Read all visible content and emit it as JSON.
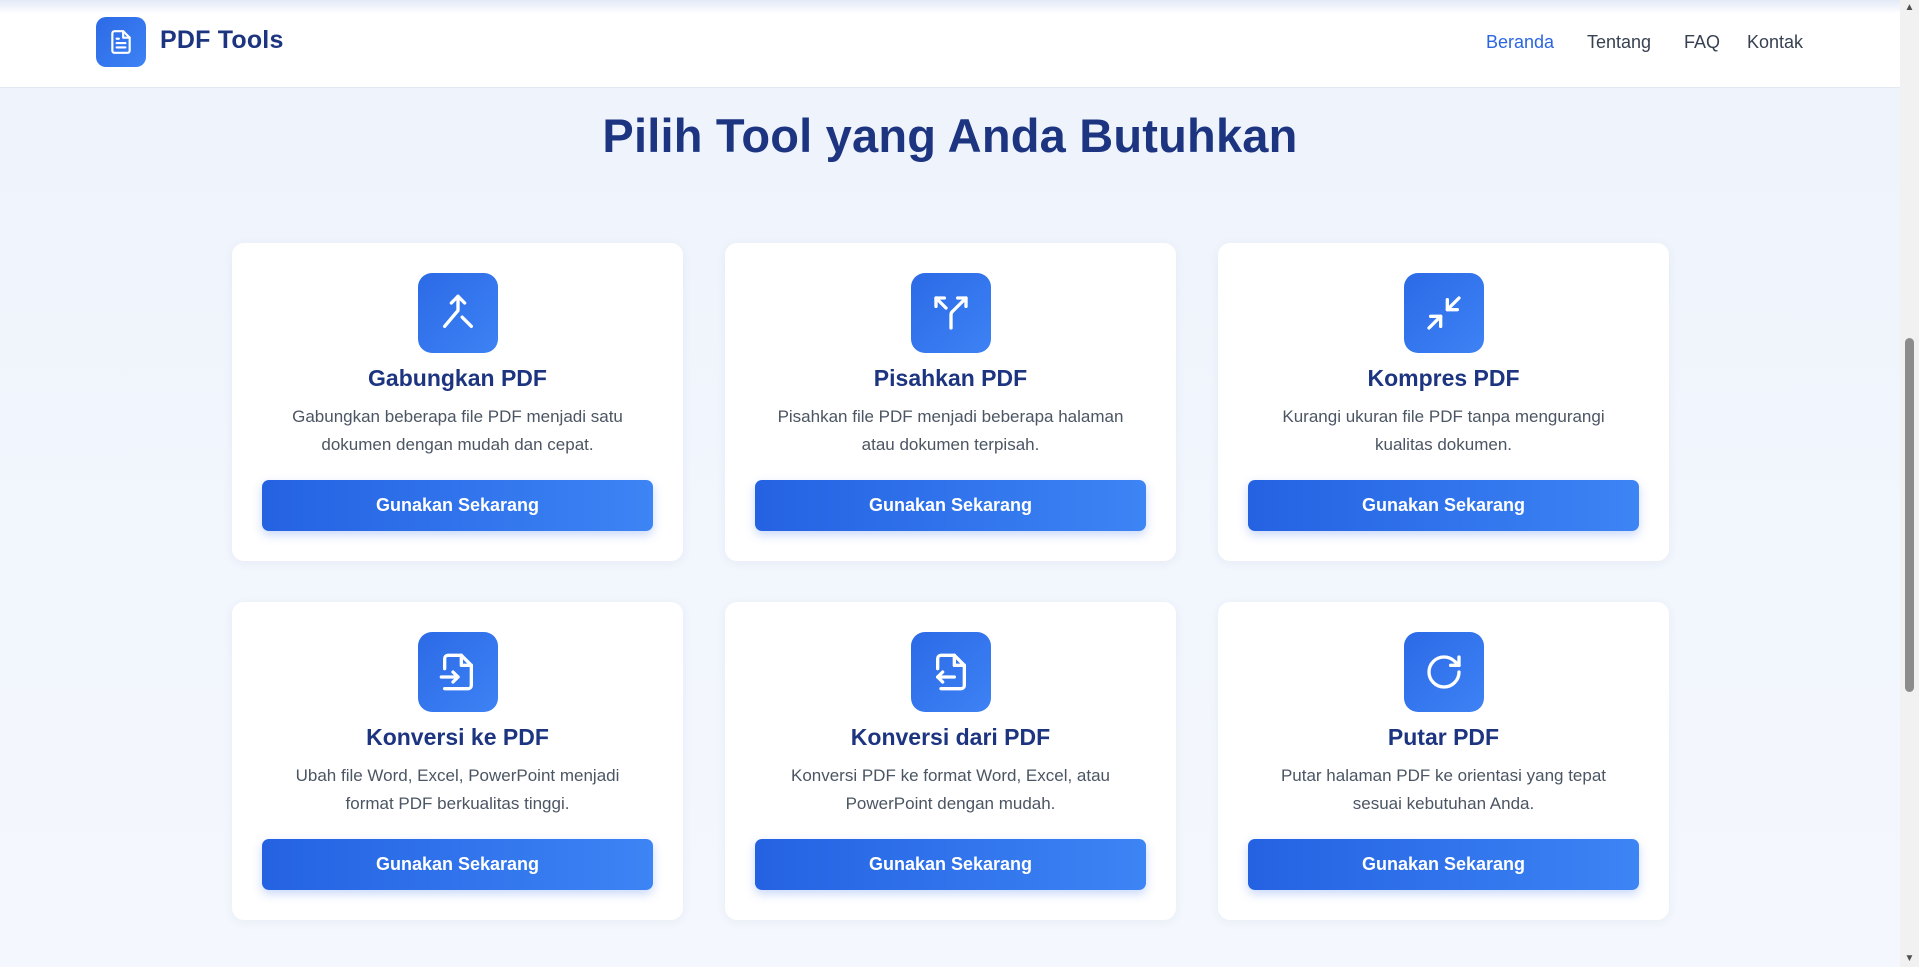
{
  "header": {
    "logo_icon": "document-icon",
    "logo_text": "PDF Tools",
    "nav": [
      {
        "label": "Beranda",
        "active": true
      },
      {
        "label": "Tentang",
        "active": false
      },
      {
        "label": "FAQ",
        "active": false
      },
      {
        "label": "Kontak",
        "active": false
      }
    ]
  },
  "main": {
    "title": "Pilih Tool yang Anda Butuhkan",
    "cards": [
      {
        "icon": "merge-icon",
        "title": "Gabungkan PDF",
        "desc_line1": "Gabungkan beberapa file PDF menjadi satu",
        "desc_line2": "dokumen dengan mudah dan cepat.",
        "button": "Gunakan Sekarang"
      },
      {
        "icon": "split-icon",
        "title": "Pisahkan PDF",
        "desc_line1": "Pisahkan file PDF menjadi beberapa halaman",
        "desc_line2": "atau dokumen terpisah.",
        "button": "Gunakan Sekarang"
      },
      {
        "icon": "compress-icon",
        "title": "Kompres PDF",
        "desc_line1": "Kurangi ukuran file PDF tanpa mengurangi",
        "desc_line2": "kualitas dokumen.",
        "button": "Gunakan Sekarang"
      },
      {
        "icon": "file-import-icon",
        "title": "Konversi ke PDF",
        "desc_line1": "Ubah file Word, Excel, PowerPoint menjadi",
        "desc_line2": "format PDF berkualitas tinggi.",
        "button": "Gunakan Sekarang"
      },
      {
        "icon": "file-export-icon",
        "title": "Konversi dari PDF",
        "desc_line1": "Konversi PDF ke format Word, Excel, atau",
        "desc_line2": "PowerPoint dengan mudah.",
        "button": "Gunakan Sekarang"
      },
      {
        "icon": "rotate-icon",
        "title": "Putar PDF",
        "desc_line1": "Putar halaman PDF ke orientasi yang tepat",
        "desc_line2": "sesuai kebutuhan Anda.",
        "button": "Gunakan Sekarang"
      }
    ]
  },
  "colors": {
    "primary": "#2a66df",
    "heading": "#1d3580",
    "text": "#4b5563",
    "background": "#eef3fc"
  }
}
